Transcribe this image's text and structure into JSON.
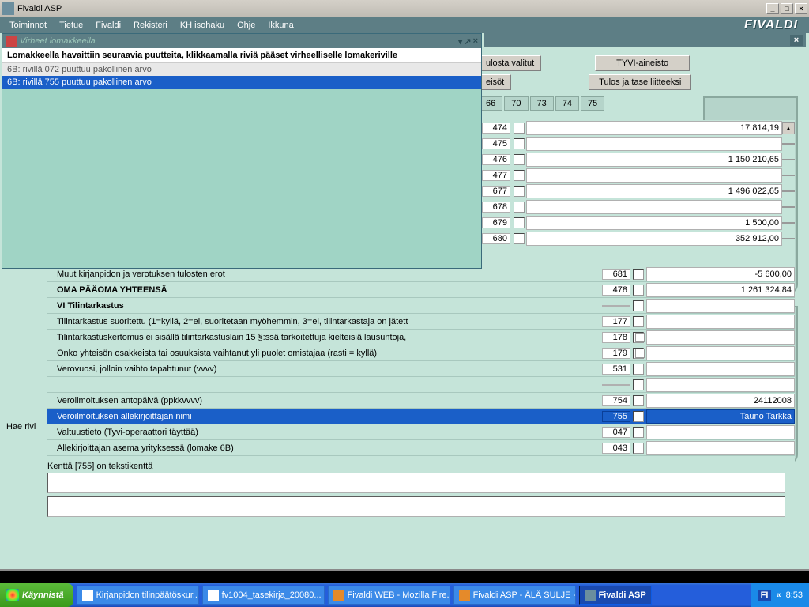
{
  "window": {
    "title": "Fivaldi ASP",
    "minimize": "_",
    "maximize": "□",
    "close": "×"
  },
  "menu": {
    "items": [
      "Toiminnot",
      "Tietue",
      "Fivaldi",
      "Rekisteri",
      "KH isohaku",
      "Ohje",
      "Ikkuna"
    ]
  },
  "brand": "FIVALDI",
  "errorwin": {
    "title": "Virheet lomakkeella",
    "header": "Lomakkeella havaittiin seuraavia puutteita, klikkaamalla riviä pääset virheelliselle lomakeriville",
    "rows": [
      "6B: rivillä 072 puuttuu pakollinen arvo",
      "6B: rivillä 755 puuttuu pakollinen arvo"
    ]
  },
  "buttons": {
    "b1": "ulosta valitut",
    "b2": "TYVI-aineisto",
    "b3": "eisöt",
    "b4": "Tulos ja tase liitteeksi"
  },
  "tabs": [
    "66",
    "70",
    "73",
    "74",
    "75"
  ],
  "top_rows": [
    {
      "code": "474",
      "val": "17 814,19"
    },
    {
      "code": "475",
      "val": ""
    },
    {
      "code": "476",
      "val": "1 150 210,65"
    },
    {
      "code": "477",
      "val": ""
    },
    {
      "code": "677",
      "val": "1 496 022,65"
    },
    {
      "code": "678",
      "val": ""
    },
    {
      "code": "679",
      "val": "1 500,00"
    },
    {
      "code": "680",
      "val": "352 912,00"
    }
  ],
  "lower_rows": [
    {
      "label": "Muut kirjanpidon ja verotuksen tulosten erot",
      "code": "681",
      "val": "-5 600,00",
      "bold": false
    },
    {
      "label": "OMA PÄÄOMA YHTEENSÄ",
      "code": "478",
      "val": "1 261 324,84",
      "bold": true
    },
    {
      "label": "VI  Tilintarkastus",
      "code": "",
      "val": "",
      "bold": true
    },
    {
      "label": "Tilintarkastus suoritettu (1=kyllä, 2=ei, suoritetaan myöhemmin, 3=ei, tilintarkastaja on jätett",
      "code": "177",
      "val": "",
      "bold": false
    },
    {
      "label": "Tilintarkastuskertomus ei sisällä tilintarkastuslain 15 §:ssä tarkoitettuja kielteisiä lausuntoja,",
      "code": "178",
      "val": "",
      "bold": false,
      "chk": true
    },
    {
      "label": "Onko yhteisön osakkeista tai osuuksista vaihtanut yli puolet omistajaa (rasti = kyllä)",
      "code": "179",
      "val": "",
      "bold": false,
      "chk": true
    },
    {
      "label": "Verovuosi, jolloin vaihto tapahtunut (vvvv)",
      "code": "531",
      "val": "",
      "bold": false
    },
    {
      "label": "",
      "code": "",
      "val": "",
      "bold": false
    },
    {
      "label": "Veroilmoituksen antopäivä (ppkkvvvv)",
      "code": "754",
      "val": "24112008",
      "bold": false
    },
    {
      "label": "Veroilmoituksen allekirjoittajan nimi",
      "code": "755",
      "val": "Tauno Tarkka",
      "bold": false,
      "sel": true
    },
    {
      "label": "Valtuustieto (Tyvi-operaattori täyttää)",
      "code": "047",
      "val": "",
      "bold": false
    },
    {
      "label": "Allekirjoittajan asema yrityksessä (lomake 6B)",
      "code": "043",
      "val": "",
      "bold": false
    }
  ],
  "status_text": "Kenttä [755] on tekstikenttä",
  "hae_rivi": "Hae rivi",
  "taskbar": {
    "start": "Käynnistä",
    "items": [
      "Kirjanpidon tilinpäätöskur...",
      "fv1004_tasekirja_20080...",
      "Fivaldi WEB - Mozilla Fire...",
      "Fivaldi ASP - ÄLÄ SULJE -...",
      "Fivaldi ASP"
    ],
    "lang": "FI",
    "chev": "«",
    "time": "8:53"
  }
}
